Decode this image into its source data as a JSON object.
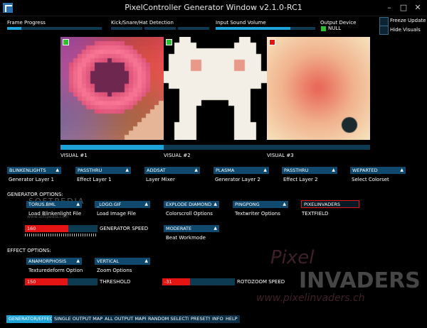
{
  "window": {
    "title": "PixelController Generator Window v2.1.0-RC1",
    "minimize": "–",
    "maximize": "□",
    "close": "✕"
  },
  "top": {
    "frame_progress_label": "Frame Progress",
    "frame_progress": 0.15,
    "beat_label": "Kick/Snare/Hat Detection",
    "input_volume_label": "Input Sound Volume",
    "input_volume": 0.75,
    "output_device_label": "Output Device",
    "output_device_value": "NULL",
    "output_device_color": "#2cc12c",
    "freeze_update": "Freeze Update",
    "hide_visuals": "Hide Visuals"
  },
  "visuals": [
    {
      "label": "VISUAL #1",
      "marker_color": "#2cc12c",
      "progress": 1.0
    },
    {
      "label": "VISUAL #2",
      "marker_color": "#2cc12c",
      "progress": 0.0
    },
    {
      "label": "VISUAL #3",
      "marker_color": "#e51414",
      "progress": 0.0
    }
  ],
  "visual_selectors": [
    {
      "value": "BLINKENLIGHTS",
      "caption": "Generator Layer 1"
    },
    {
      "value": "PASSTHRU",
      "caption": "Effect Layer 1"
    },
    {
      "value": "ADDSAT",
      "caption": "Layer Mixer"
    },
    {
      "value": "PLASMA",
      "caption": "Generator Layer 2"
    },
    {
      "value": "PASSTHRU",
      "caption": "Effect Layer 2"
    },
    {
      "value": "WEPARTED",
      "caption": "Select Colorset"
    }
  ],
  "generator_options": {
    "heading": "GENERATOR OPTIONS:",
    "blinken_file": "TORUS.BML",
    "blinken_caption": "Load Blinkenlight File",
    "image_file": "_LOGO.GIF",
    "image_caption": "Load Image File",
    "colorscroll": "EXPLODE DIAMOND",
    "colorscroll_caption": "Colorscroll Options",
    "textwriter": "PINGPONG",
    "textwriter_caption": "Textwriter Options",
    "textfield_value": "PIXELINVADERS",
    "textfield_caption": "TEXTFIELD",
    "speed_value": "160",
    "speed_fraction": 0.6,
    "speed_label": "GENERATOR SPEED",
    "beat_workmode": "MODERATE",
    "beat_workmode_caption": "Beat Workmode"
  },
  "effect_options": {
    "heading": "EFFECT OPTIONS:",
    "texture": "ANAMORPHOSIS",
    "texture_caption": "Texturedeform Option",
    "zoom": "VERTICAL",
    "zoom_caption": "Zoom Options",
    "threshold_value": "150",
    "threshold_fraction": 0.59,
    "threshold_label": "THRESHOLD",
    "rotozoom_value": "-31",
    "rotozoom_fraction": 0.38,
    "rotozoom_label": "ROTOZOOM SPEED"
  },
  "watermark": {
    "brand1": "Pixel",
    "brand2": "INVADERS",
    "site": "www.pixelinvaders.ch",
    "softpedia": "SOFTPEDIA",
    "softpedia_url": "www.softpedia.com"
  },
  "tabs": [
    {
      "label": "GENERATOR/EFFECT"
    },
    {
      "label": "SINGLE OUTPUT MAPPING"
    },
    {
      "label": "ALL OUTPUT MAPPING"
    },
    {
      "label": "RANDOM SELECTION"
    },
    {
      "label": "PRESETS"
    },
    {
      "label": "INFO"
    },
    {
      "label": "HELP"
    }
  ]
}
